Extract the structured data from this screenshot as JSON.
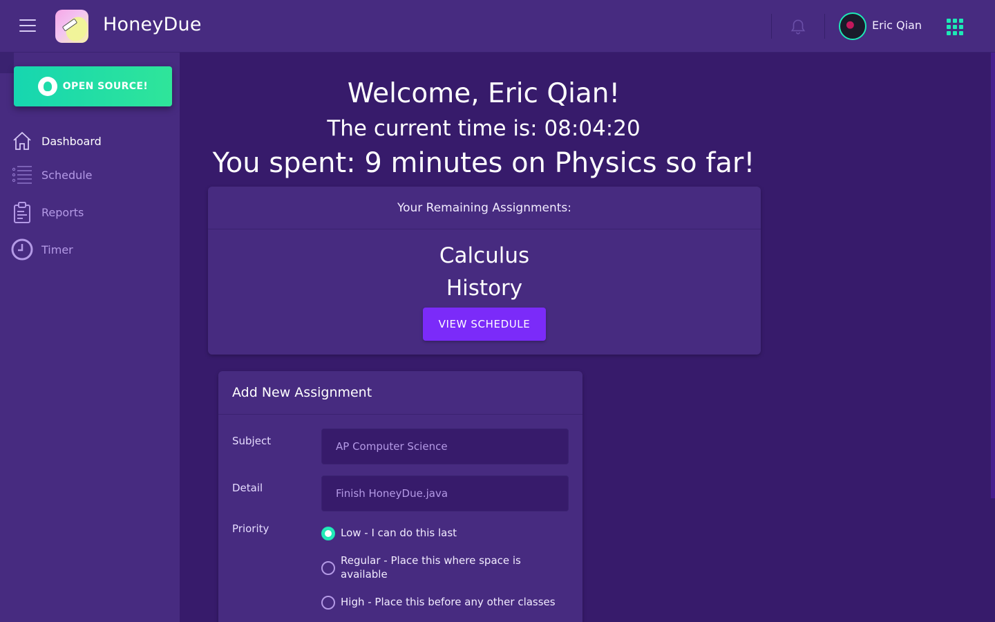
{
  "header": {
    "brand": "HoneyDue",
    "user_name": "Eric Qian"
  },
  "sidebar": {
    "open_source_label": "OPEN SOURCE!",
    "items": [
      {
        "label": "Dashboard",
        "icon": "home-icon",
        "active": true
      },
      {
        "label": "Schedule",
        "icon": "list-icon",
        "active": false
      },
      {
        "label": "Reports",
        "icon": "clipboard-icon",
        "active": false
      },
      {
        "label": "Timer",
        "icon": "clock-icon",
        "active": false
      }
    ]
  },
  "welcome": {
    "greeting": "Welcome, Eric Qian!",
    "time_line": "The current time is: 08:04:20",
    "spent_line": "You spent: 9 minutes on Physics so far!"
  },
  "assignments": {
    "heading": "Your Remaining Assignments:",
    "subjects": [
      "Calculus",
      "History"
    ],
    "button_label": "VIEW SCHEDULE"
  },
  "new_assignment": {
    "heading": "Add New Assignment",
    "subject_label": "Subject",
    "subject_placeholder": "AP Computer Science",
    "detail_label": "Detail",
    "detail_placeholder": "Finish HoneyDue.java",
    "priority_label": "Priority",
    "priority_options": [
      {
        "label": "Low - I can do this last",
        "checked": true
      },
      {
        "label": "Regular - Place this where space is available",
        "checked": false
      },
      {
        "label": "High - Place this before any other classes",
        "checked": false
      }
    ]
  },
  "colors": {
    "background": "#371b6b",
    "panel": "#472b80",
    "accent_teal": "#1de9b6",
    "accent_purple": "#7b2bf9",
    "muted_text": "#b49ae6"
  }
}
